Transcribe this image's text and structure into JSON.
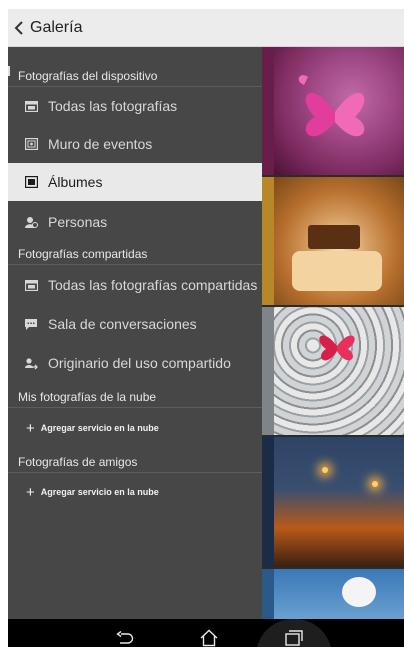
{
  "header": {
    "title": "Galería",
    "back_icon": "chevron-left-icon"
  },
  "sections": {
    "device": {
      "label": "Fotografías del dispositivo"
    },
    "shared": {
      "label": "Fotografías compartidas"
    },
    "cloud": {
      "label": "Mis fotografías de la nube"
    },
    "friends": {
      "label": "Fotografías de amigos"
    }
  },
  "device_items": [
    {
      "label": "Todas las fotografías",
      "icon": "photos-icon"
    },
    {
      "label": "Muro de eventos",
      "icon": "events-icon"
    },
    {
      "label": "Álbumes",
      "icon": "albums-icon",
      "selected": true
    },
    {
      "label": "Personas",
      "icon": "people-icon"
    }
  ],
  "shared_items": [
    {
      "label": "Todas las fotografías compartidas",
      "icon": "shared-photos-icon"
    },
    {
      "label": "Sala de conversaciones",
      "icon": "chat-icon"
    },
    {
      "label": "Originario del uso compartido",
      "icon": "share-origin-icon"
    }
  ],
  "cloud_add": {
    "label": "Agregar servicio en la nube"
  },
  "friends_add": {
    "label": "Agregar servicio en la nube"
  },
  "navbar": {
    "back_icon": "back-icon",
    "home_icon": "home-icon",
    "recents_icon": "recents-icon"
  },
  "colors": {
    "drawer": "#474747",
    "selected": "#e9e9e9",
    "actionbar": "#ececec"
  }
}
